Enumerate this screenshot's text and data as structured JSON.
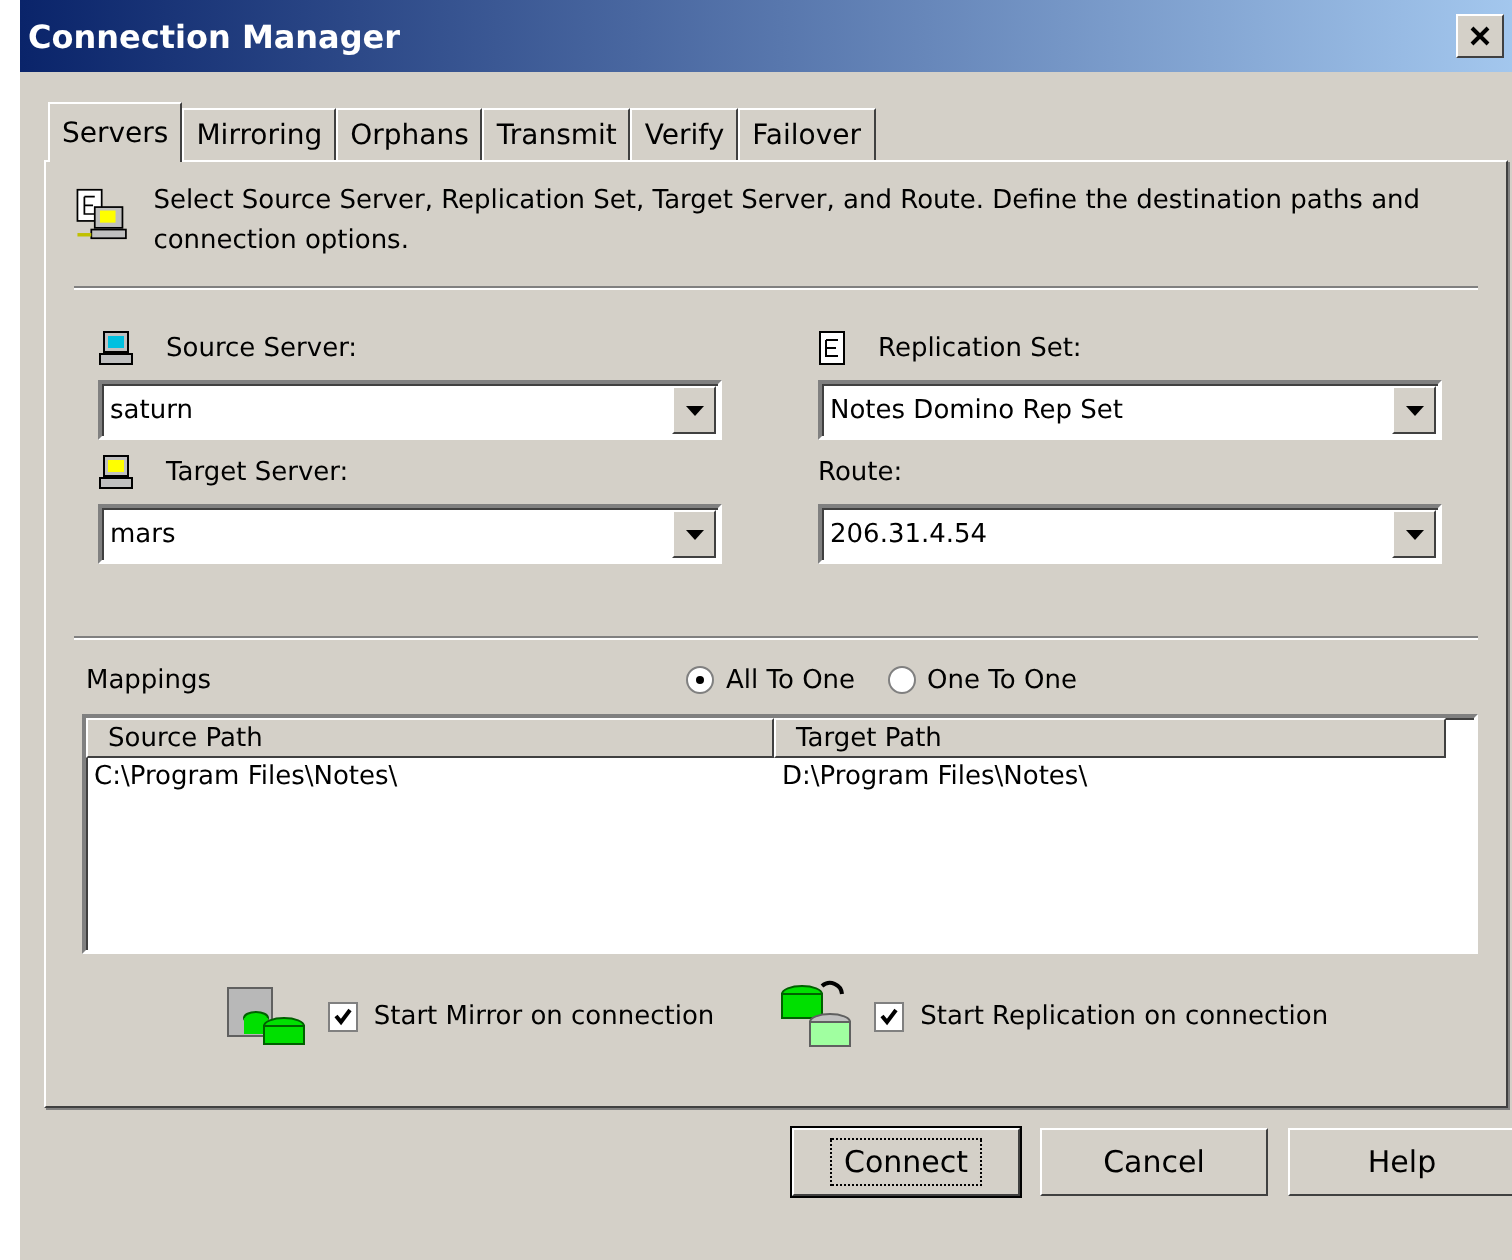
{
  "window": {
    "title": "Connection Manager"
  },
  "tabs": [
    {
      "label": "Servers",
      "selected": true
    },
    {
      "label": "Mirroring",
      "selected": false
    },
    {
      "label": "Orphans",
      "selected": false
    },
    {
      "label": "Transmit",
      "selected": false
    },
    {
      "label": "Verify",
      "selected": false
    },
    {
      "label": "Failover",
      "selected": false
    }
  ],
  "intro": "Select Source Server, Replication Set, Target Server, and Route.  Define the destination paths and connection options.",
  "fields": [
    {
      "label": "Source Server:",
      "value": "saturn",
      "kind": "source"
    },
    {
      "label": "Replication Set:",
      "value": "Notes Domino Rep Set",
      "kind": "set"
    },
    {
      "label": "Target Server:",
      "value": "mars",
      "kind": "target"
    },
    {
      "label": "Route:",
      "value": "206.31.4.54",
      "kind": "route"
    }
  ],
  "mappings": {
    "label": "Mappings",
    "modes": [
      {
        "label": "All To One",
        "selected": true
      },
      {
        "label": "One To One",
        "selected": false
      }
    ],
    "columns": [
      "Source Path",
      "Target Path"
    ],
    "rows": [
      [
        "C:\\Program Files\\Notes\\",
        "D:\\Program Files\\Notes\\"
      ]
    ]
  },
  "options": [
    {
      "label": "Start Mirror on connection",
      "checked": true,
      "kind": "mirror"
    },
    {
      "label": "Start Replication on connection",
      "checked": true,
      "kind": "replication"
    }
  ],
  "buttons": [
    {
      "label": "Connect",
      "default": true
    },
    {
      "label": "Cancel",
      "default": false
    },
    {
      "label": "Help",
      "default": false
    }
  ]
}
